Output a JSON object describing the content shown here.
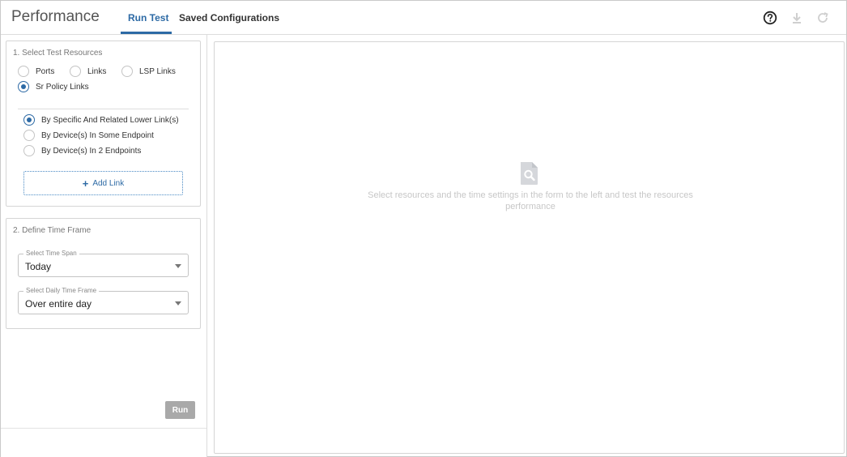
{
  "header": {
    "title": "Performance",
    "tabs": [
      {
        "label": "Run Test",
        "active": true
      },
      {
        "label": "Saved Configurations",
        "active": false
      }
    ],
    "icons": [
      "help-icon",
      "download-icon",
      "refresh-icon"
    ]
  },
  "resources": {
    "title": "1. Select Test Resources",
    "types": [
      {
        "label": "Ports",
        "checked": false
      },
      {
        "label": "Links",
        "checked": false
      },
      {
        "label": "LSP Links",
        "checked": false
      },
      {
        "label": "Sr Policy Links",
        "checked": true
      }
    ],
    "modes": [
      {
        "label": "By Specific And Related Lower Link(s)",
        "checked": true
      },
      {
        "label": "By Device(s) In Some Endpoint",
        "checked": false
      },
      {
        "label": "By Device(s) In 2 Endpoints",
        "checked": false
      }
    ],
    "add_link_label": "Add Link"
  },
  "timeframe": {
    "title": "2. Define Time Frame",
    "time_span": {
      "legend": "Select Time Span",
      "value": "Today"
    },
    "daily": {
      "legend": "Select Daily Time Frame",
      "value": "Over entire day"
    }
  },
  "actions": {
    "run_label": "Run"
  },
  "results": {
    "empty_message": "Select resources and the time settings in the form to the left and test the resources performance"
  },
  "colors": {
    "accent": "#2d6aa5",
    "disabled_button": "#a9a9a9",
    "placeholder_text": "#c7c7c7"
  }
}
